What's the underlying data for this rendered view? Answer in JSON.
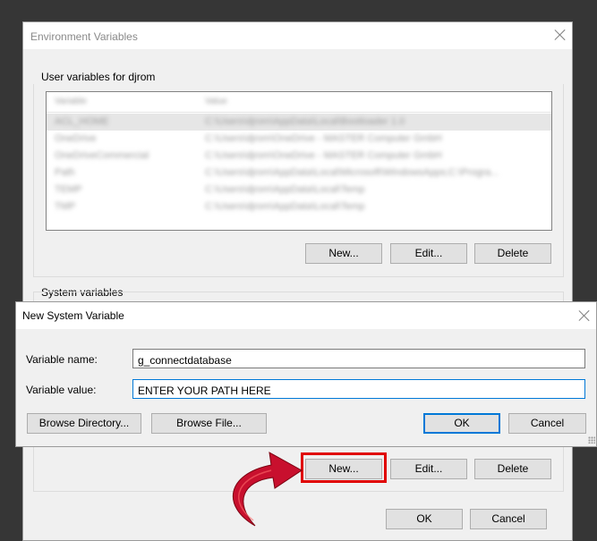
{
  "env_window": {
    "title": "Environment Variables",
    "user_vars": {
      "label": "User variables for djrom",
      "columns": [
        "Variable",
        "Value"
      ],
      "rows": [
        {
          "name": "ACL_HOME",
          "value": "C:\\Users\\djrom\\AppData\\Local\\Bootloader 1.0"
        },
        {
          "name": "OneDrive",
          "value": "C:\\Users\\djrom\\OneDrive - MASTER Computer GmbH"
        },
        {
          "name": "OneDriveCommercial",
          "value": "C:\\Users\\djrom\\OneDrive - MASTER Computer GmbH"
        },
        {
          "name": "Path",
          "value": "C:\\Users\\djrom\\AppData\\Local\\Microsoft\\WindowsApps;C:\\Progra..."
        },
        {
          "name": "TEMP",
          "value": "C:\\Users\\djrom\\AppData\\Local\\Temp"
        },
        {
          "name": "TMP",
          "value": "C:\\Users\\djrom\\AppData\\Local\\Temp"
        }
      ],
      "buttons": {
        "new": "New...",
        "edit": "Edit...",
        "delete": "Delete"
      }
    },
    "system_vars": {
      "label": "System variables",
      "buttons": {
        "new": "New...",
        "edit": "Edit...",
        "delete": "Delete"
      }
    },
    "footer": {
      "ok": "OK",
      "cancel": "Cancel"
    }
  },
  "new_system_variable_dialog": {
    "title": "New System Variable",
    "variable_name_label": "Variable name:",
    "variable_name_value": "g_connectdatabase",
    "variable_value_label": "Variable value:",
    "variable_value_value": "ENTER YOUR PATH HERE",
    "buttons": {
      "browse_directory": "Browse Directory...",
      "browse_file": "Browse File...",
      "ok": "OK",
      "cancel": "Cancel"
    }
  },
  "colors": {
    "highlight": "#e00000",
    "arrow": "#c8102e",
    "accent": "#0078d7"
  },
  "icons": [
    "close-icon",
    "curved-arrow-icon"
  ]
}
